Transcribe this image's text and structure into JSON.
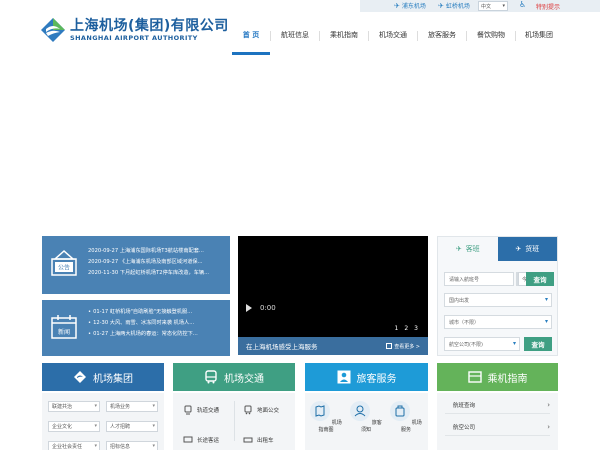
{
  "topbar": {
    "pudong_label": "浦东机场",
    "hongqiao_label": "虹桥机场",
    "language": "中文",
    "special_label": "特别提示"
  },
  "header": {
    "logo_cn": "上海机场(集团)有限公司",
    "logo_en": "SHANGHAI AIRPORT AUTHORITY"
  },
  "nav": {
    "items": [
      "首 页",
      "航班信息",
      "乘机指南",
      "机场交通",
      "旅客服务",
      "餐饮购物",
      "机场集团"
    ]
  },
  "notices": {
    "icon_label": "公告",
    "lines": [
      "2020-09-27  上海浦东国际机场T3航站楼南配套...",
      "2020-09-27  《上海浦东机场及南部区域河道保...",
      "2020-11-30  下月起虹桥机场T2停车库改造，车辆..."
    ]
  },
  "news": {
    "icon_label": "新闻",
    "lines": [
      "01-17  虹桥机场\"自助刷脸\"无接触登机服...",
      "12-30  大风、雨雪、冰冻同时来袭 机场人...",
      "01-27  上海两大机场的春运：常态化防控下..."
    ]
  },
  "video": {
    "time": "0:00",
    "pages": [
      "1",
      "2",
      "3"
    ],
    "caption": "在上海机场感受上海服务",
    "more_label": "查看更多 >"
  },
  "flight": {
    "tab_passenger": "客班",
    "tab_cargo": "货班",
    "flight_placeholder": "请输入航班号",
    "date_value": "今天",
    "query_label": "查询",
    "route_value": "国内出发",
    "city_value": "城市（不限）",
    "airline_value": "航空公司(不限)",
    "query2_label": "查询"
  },
  "categories": {
    "group": "机场集团",
    "transport": "机场交通",
    "service": "旅客服务",
    "guide": "乘机指南"
  },
  "group_selects": [
    "联建共治",
    "机场业务",
    "企业文化",
    "人才招聘",
    "企业社会责任",
    "招标信息"
  ],
  "transport_items": [
    "轨道交通",
    "地面公交",
    "长途客运",
    "出租车"
  ],
  "service_items": [
    "机场指南图",
    "旅客须知",
    "机场服务"
  ],
  "guide_items": [
    "航班查询",
    "航空公司"
  ],
  "colors": {
    "brand_blue": "#2c6ea9",
    "green": "#3f9f83",
    "sky": "#1e9bd7",
    "lime": "#64b35a",
    "panel_blue": "#4a82b4"
  }
}
